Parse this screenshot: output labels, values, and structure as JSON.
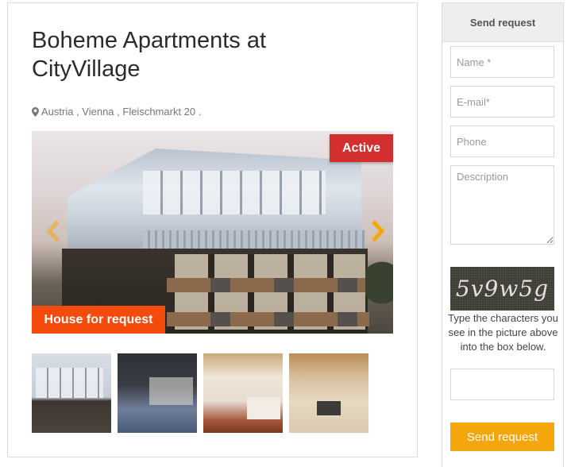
{
  "listing": {
    "title": "Boheme Apartments at CityVillage",
    "address": "Austria , Vienna , Fleischmarkt 20 .",
    "icons": {
      "location": "map-marker-icon"
    },
    "status_badge": "Active",
    "request_badge": "House for request",
    "colors": {
      "active_badge": "#d32f2f",
      "request_badge": "#f44a0c",
      "slider_arrow": "#f5a60b"
    },
    "slider": {
      "prev_icon": "chevron-left-icon",
      "next_icon": "chevron-right-icon",
      "main_image": "Modern apartment building exterior with rooftop terrace"
    },
    "thumbnails": [
      {
        "alt": "Building exterior"
      },
      {
        "alt": "Terrace lounge"
      },
      {
        "alt": "Living room with fireplace"
      },
      {
        "alt": "Living room with wooden beams"
      }
    ]
  },
  "request_form": {
    "header": "Send request",
    "fields": {
      "name_placeholder": "Name *",
      "email_placeholder": "E-mail*",
      "phone_placeholder": "Phone",
      "description_placeholder": "Description",
      "captcha_value": ""
    },
    "captcha": {
      "image_text": "5v9w5g",
      "help_text": "Type the characters you see in the picture above into the box below."
    },
    "submit_label": "Send request",
    "colors": {
      "submit": "#f5a60b",
      "header_bg": "#eeeeee"
    }
  }
}
